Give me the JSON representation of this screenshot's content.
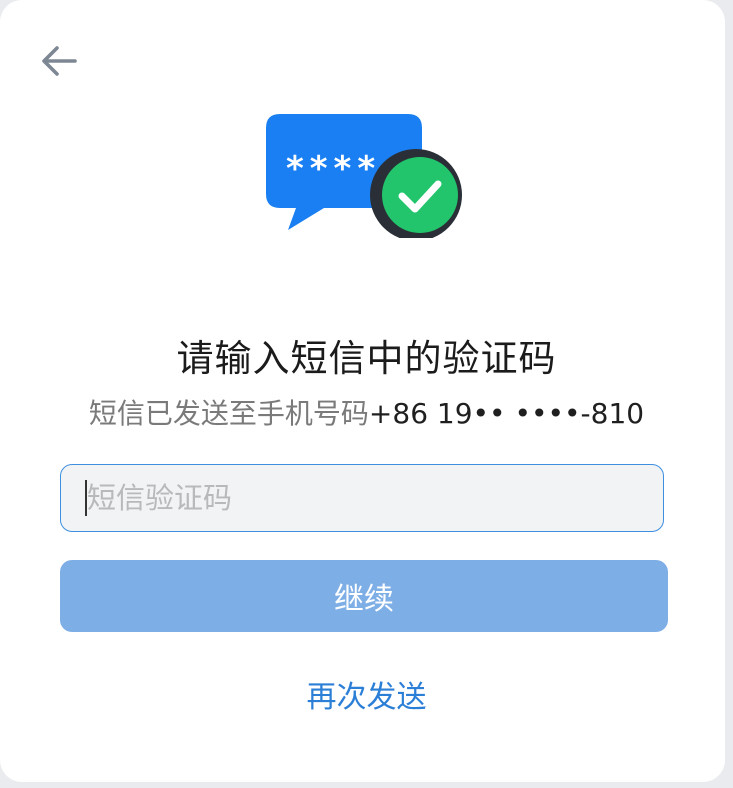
{
  "header": {
    "back_icon": "arrow-left-icon"
  },
  "hero": {
    "bubble_icon": "chat-bubble-icon",
    "masked_code": "****",
    "check_icon": "checkmark-circle-icon",
    "bubble_color": "#1a7ff2",
    "check_color": "#22c56b"
  },
  "title": "请输入短信中的验证码",
  "subtitle": {
    "prefix": "短信已发送至手机号码",
    "phone": "+86 19•• ••••-810"
  },
  "code_input": {
    "placeholder": "短信验证码",
    "value": ""
  },
  "continue_button": {
    "label": "继续"
  },
  "resend_link": {
    "label": "再次发送"
  },
  "colors": {
    "accent": "#2c7fd6",
    "button_disabled": "#7eaee6",
    "input_border": "#3d8fe0"
  }
}
